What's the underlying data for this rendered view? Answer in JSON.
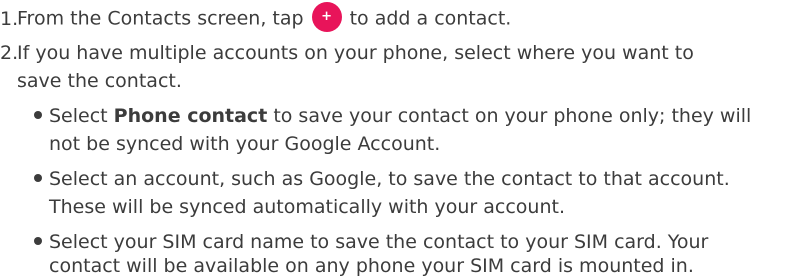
{
  "steps": {
    "step1": {
      "number": "1.",
      "before": "From the Contacts screen, tap",
      "icon": "add-contact-plus",
      "icon_glyph": "+",
      "icon_color": "#e8145a",
      "after": "to add a contact."
    },
    "step2": {
      "number": "2.",
      "line1": "If you have multiple accounts on your phone, select where you want to",
      "line2": "save the contact."
    }
  },
  "options": [
    {
      "prefix": "Select ",
      "bold": "Phone contact",
      "line1_rest": " to save your contact on your phone only; they will",
      "line2": "not be synced with your Google Account."
    },
    {
      "line1": "Select an account, such as Google, to save the contact to that account.",
      "line2": "These will be synced automatically with your account."
    },
    {
      "line1": "Select your SIM card name to save the contact to your SIM card. Your",
      "line2": "contact will be available on any phone your SIM card is mounted in."
    }
  ]
}
